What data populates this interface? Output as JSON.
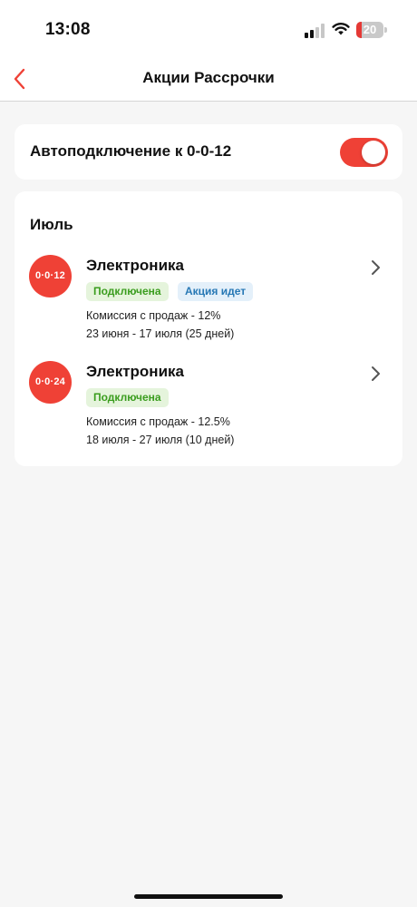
{
  "status_bar": {
    "time": "13:08",
    "battery_level": "20",
    "battery_fraction": 0.2,
    "icons": [
      "cellular-signal-icon",
      "wifi-icon",
      "battery-icon"
    ]
  },
  "nav": {
    "title": "Акции Рассрочки",
    "back_icon": "chevron-left-icon"
  },
  "auto_connect": {
    "label": "Автоподключение к 0-0-12",
    "enabled": true
  },
  "month": {
    "title": "Июль",
    "promos": [
      {
        "badge": "0·0·12",
        "name": "Электроника",
        "tags": [
          {
            "label": "Подключена",
            "color": "#3a9d1e"
          },
          {
            "label": "Акция идет",
            "color": "#2778b5"
          }
        ],
        "commission": "Комиссия с продаж - 12%",
        "dates": "23 июня - 17 июля (25 дней)"
      },
      {
        "badge": "0·0·24",
        "name": "Электроника",
        "tags": [
          {
            "label": "Подключена",
            "color": "#3a9d1e"
          }
        ],
        "commission": "Комиссия с продаж - 12.5%",
        "dates": "18 июля - 27 июля (10 дней)"
      }
    ]
  },
  "colors": {
    "accent": "#ef4136",
    "tag_green_bg": "#e5f4dc",
    "tag_blue_bg": "#e4f0fa",
    "background": "#f6f6f6"
  }
}
